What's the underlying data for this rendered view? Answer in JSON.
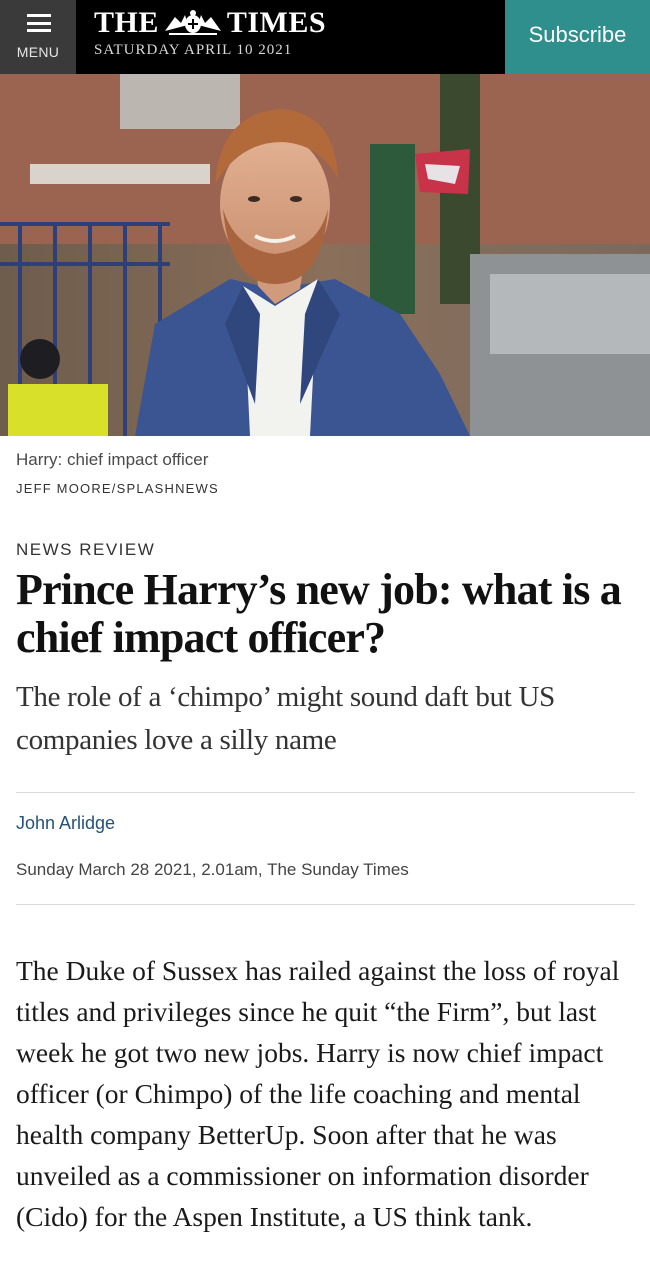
{
  "header": {
    "menu_label": "MENU",
    "masthead_left": "THE",
    "masthead_right": "TIMES",
    "masthead_date": "SATURDAY APRIL 10 2021",
    "subscribe_label": "Subscribe",
    "colors": {
      "bar": "#000000",
      "menu_bg": "#3a3a3a",
      "subscribe_bg": "#2e8f8d"
    }
  },
  "hero": {
    "caption": "Harry: chief impact officer",
    "credit": "JEFF MOORE/SPLASHNEWS"
  },
  "article": {
    "section": "NEWS REVIEW",
    "headline": "Prince Harry’s new job: what is a chief impact officer?",
    "standfirst": "The role of a ‘chimpo’ might sound daft but US companies love a silly name",
    "author": "John Arlidge",
    "dateline": "Sunday March 28 2021, 2.01am, The Sunday Times",
    "body": "The Duke of Sussex has railed against the loss of royal titles and privileges since he quit “the Firm”, but last week he got two new jobs. Harry is now chief impact officer (or Chimpo) of the life coaching and mental health company BetterUp. Soon after that he was unveiled as a commissioner on information disorder (Cido) for the Aspen Institute, a US think tank.",
    "colors": {
      "byline": "#24527a"
    }
  }
}
